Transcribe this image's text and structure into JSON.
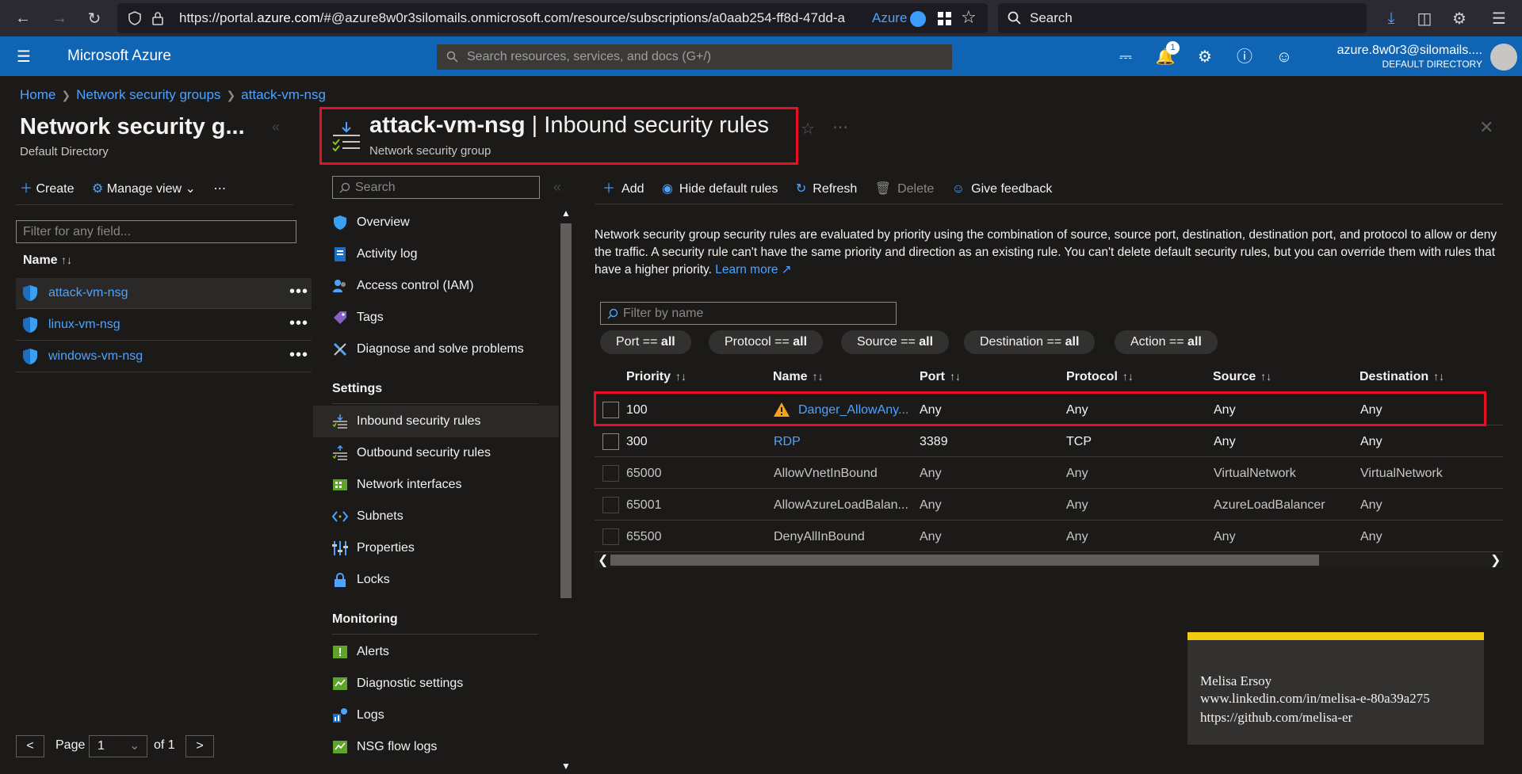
{
  "browser": {
    "url_prefix": "https://portal.",
    "url_domain": "azure.com",
    "url_rest": "/#@azure8w0r3silomails.onmicrosoft.com/resource/subscriptions/a0aab254-ff8d-47dd-a",
    "container_label": "Azure",
    "search_placeholder": "Search"
  },
  "header": {
    "brand": "Microsoft Azure",
    "search_placeholder": "Search resources, services, and docs (G+/)",
    "notification_count": "1",
    "account_name": "azure.8w0r3@silomails....",
    "account_directory": "DEFAULT DIRECTORY"
  },
  "breadcrumb": [
    "Home",
    "Network security groups",
    "attack-vm-nsg"
  ],
  "left_panel": {
    "title": "Network security g...",
    "subtitle": "Default Directory",
    "create_label": "Create",
    "manage_view_label": "Manage view",
    "filter_placeholder": "Filter for any field...",
    "col_name": "Name",
    "items": [
      "attack-vm-nsg",
      "linux-vm-nsg",
      "windows-vm-nsg"
    ],
    "page_label": "Page",
    "page_value": "1",
    "page_of": "of 1",
    "prev": "<",
    "next": ">"
  },
  "resource": {
    "name": "attack-vm-nsg",
    "section": "Inbound security rules",
    "type": "Network security group"
  },
  "menu": {
    "search_placeholder": "Search",
    "items_top": [
      "Overview",
      "Activity log",
      "Access control (IAM)",
      "Tags",
      "Diagnose and solve problems"
    ],
    "settings_header": "Settings",
    "items_settings": [
      "Inbound security rules",
      "Outbound security rules",
      "Network interfaces",
      "Subnets",
      "Properties",
      "Locks"
    ],
    "monitoring_header": "Monitoring",
    "items_monitoring": [
      "Alerts",
      "Diagnostic settings",
      "Logs",
      "NSG flow logs"
    ]
  },
  "toolbar": {
    "add": "Add",
    "hide_default": "Hide default rules",
    "refresh": "Refresh",
    "delete": "Delete",
    "feedback": "Give feedback"
  },
  "description": "Network security group security rules are evaluated by priority using the combination of source, source port, destination, destination port, and protocol to allow or deny the traffic. A security rule can't have the same priority and direction as an existing rule. You can't delete default security rules, but you can override them with rules that have a higher priority.",
  "learn_more": "Learn more",
  "filter_placeholder": "Filter by name",
  "pills": [
    {
      "key": "Port == ",
      "val": "all"
    },
    {
      "key": "Protocol == ",
      "val": "all"
    },
    {
      "key": "Source == ",
      "val": "all"
    },
    {
      "key": "Destination == ",
      "val": "all"
    },
    {
      "key": "Action == ",
      "val": "all"
    }
  ],
  "columns": [
    "Priority",
    "Name",
    "Port",
    "Protocol",
    "Source",
    "Destination"
  ],
  "rows": [
    {
      "priority": "100",
      "name": "Danger_AllowAny...",
      "port": "Any",
      "protocol": "Any",
      "source": "Any",
      "destination": "Any"
    },
    {
      "priority": "300",
      "name": "RDP",
      "port": "3389",
      "protocol": "TCP",
      "source": "Any",
      "destination": "Any"
    },
    {
      "priority": "65000",
      "name": "AllowVnetInBound",
      "port": "Any",
      "protocol": "Any",
      "source": "VirtualNetwork",
      "destination": "VirtualNetwork"
    },
    {
      "priority": "65001",
      "name": "AllowAzureLoadBalan...",
      "port": "Any",
      "protocol": "Any",
      "source": "AzureLoadBalancer",
      "destination": "Any"
    },
    {
      "priority": "65500",
      "name": "DenyAllInBound",
      "port": "Any",
      "protocol": "Any",
      "source": "Any",
      "destination": "Any"
    }
  ],
  "watermark": {
    "line1": "Melisa Ersoy",
    "line2": "www.linkedin.com/in/melisa-e-80a39a275",
    "line3": "https://github.com/melisa-er"
  },
  "colors": {
    "accent": "#0f64b4",
    "link": "#4da3ff",
    "highlight": "#e81123",
    "warning": "#f7a21b"
  }
}
